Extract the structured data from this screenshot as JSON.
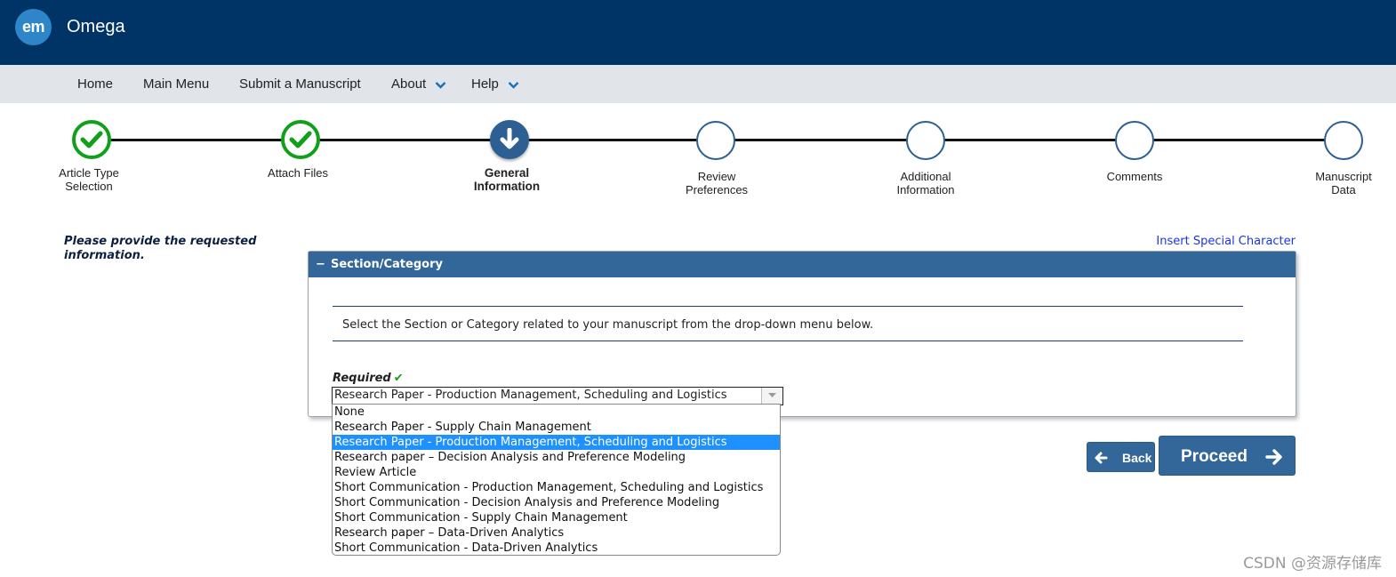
{
  "header": {
    "logo_text": "em",
    "app_name": "Omega"
  },
  "nav": {
    "items": [
      {
        "label": "Home"
      },
      {
        "label": "Main Menu"
      },
      {
        "label": "Submit a Manuscript"
      },
      {
        "label": "About",
        "has_dropdown": true
      },
      {
        "label": "Help",
        "has_dropdown": true
      }
    ]
  },
  "steps": [
    {
      "line1": "Article Type",
      "line2": "Selection",
      "state": "done"
    },
    {
      "line1": "Attach Files",
      "line2": "",
      "state": "done"
    },
    {
      "line1": "General",
      "line2": "Information",
      "state": "current"
    },
    {
      "line1": "Review",
      "line2": "Preferences",
      "state": "todo"
    },
    {
      "line1": "Additional",
      "line2": "Information",
      "state": "todo"
    },
    {
      "line1": "Comments",
      "line2": "",
      "state": "todo"
    },
    {
      "line1": "Manuscript",
      "line2": "Data",
      "state": "todo"
    }
  ],
  "main": {
    "prompt": "Please provide the requested information.",
    "insert_special_link": "Insert Special Character",
    "panel": {
      "title": "Section/Category",
      "collapse_symbol": "−",
      "instruction": "Select the Section or Category related to your manuscript from the drop-down menu below.",
      "required_label": "Required",
      "required_check": "✔",
      "select_value": "Research Paper - Production Management, Scheduling and Logistics"
    },
    "dropdown_options": [
      "None",
      "Research Paper - Supply Chain Management",
      "Research Paper - Production Management, Scheduling and Logistics",
      "Research paper – Decision Analysis and Preference Modeling",
      "Review Article",
      "Short Communication - Production Management, Scheduling and Logistics",
      "Short Communication - Decision Analysis and Preference Modeling",
      "Short Communication - Supply Chain Management",
      "Research paper – Data-Driven Analytics",
      "Short Communication - Data-Driven Analytics"
    ],
    "selected_option_index": 2
  },
  "buttons": {
    "back": "Back",
    "proceed": "Proceed"
  },
  "watermark": "CSDN @资源存储库",
  "colors": {
    "header_bg": "#003366",
    "nav_bg": "#e1e4e8",
    "accent": "#336699",
    "done_green": "#11a01a",
    "highlight": "#1e90ff"
  }
}
